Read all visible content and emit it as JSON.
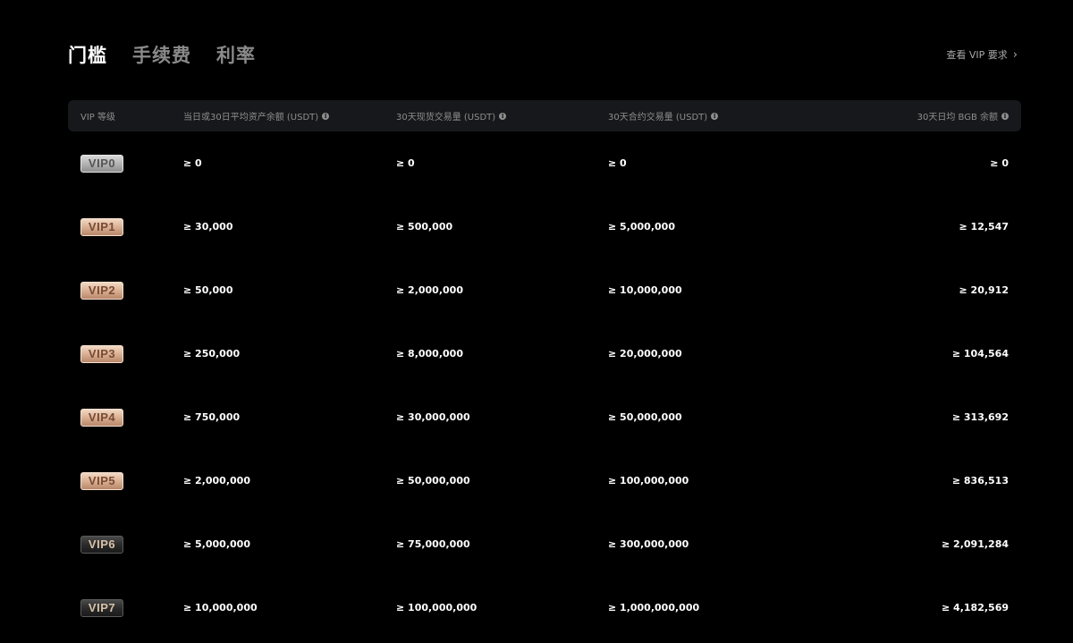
{
  "tabs": [
    {
      "label": "门槛",
      "active": true
    },
    {
      "label": "手续费",
      "active": false
    },
    {
      "label": "利率",
      "active": false
    }
  ],
  "vip_link": {
    "label": "查看 VIP 要求"
  },
  "table": {
    "headers": [
      "VIP 等级",
      "当日或30日平均资产余额 (USDT)",
      "30天现货交易量 (USDT)",
      "30天合约交易量 (USDT)",
      "30天日均 BGB 余额"
    ],
    "rows": [
      {
        "level": "VIP0",
        "style": "silver",
        "asset": "≥ 0",
        "spot": "≥ 0",
        "futures": "≥ 0",
        "bgb": "≥ 0"
      },
      {
        "level": "VIP1",
        "style": "gold",
        "asset": "≥ 30,000",
        "spot": "≥ 500,000",
        "futures": "≥ 5,000,000",
        "bgb": "≥ 12,547"
      },
      {
        "level": "VIP2",
        "style": "gold",
        "asset": "≥ 50,000",
        "spot": "≥ 2,000,000",
        "futures": "≥ 10,000,000",
        "bgb": "≥ 20,912"
      },
      {
        "level": "VIP3",
        "style": "gold",
        "asset": "≥ 250,000",
        "spot": "≥ 8,000,000",
        "futures": "≥ 20,000,000",
        "bgb": "≥ 104,564"
      },
      {
        "level": "VIP4",
        "style": "gold",
        "asset": "≥ 750,000",
        "spot": "≥ 30,000,000",
        "futures": "≥ 50,000,000",
        "bgb": "≥ 313,692"
      },
      {
        "level": "VIP5",
        "style": "gold",
        "asset": "≥ 2,000,000",
        "spot": "≥ 50,000,000",
        "futures": "≥ 100,000,000",
        "bgb": "≥ 836,513"
      },
      {
        "level": "VIP6",
        "style": "dark",
        "asset": "≥ 5,000,000",
        "spot": "≥ 75,000,000",
        "futures": "≥ 300,000,000",
        "bgb": "≥ 2,091,284"
      },
      {
        "level": "VIP7",
        "style": "dark",
        "asset": "≥ 10,000,000",
        "spot": "≥ 100,000,000",
        "futures": "≥ 1,000,000,000",
        "bgb": "≥ 4,182,569"
      }
    ]
  },
  "colors": {
    "background": "#000000",
    "header_bg": "#17181b",
    "muted_text": "#8e8e8e",
    "tab_inactive": "#8a8a8a"
  },
  "icons": {
    "info": "info-icon",
    "chevron": "chevron-right-icon"
  }
}
